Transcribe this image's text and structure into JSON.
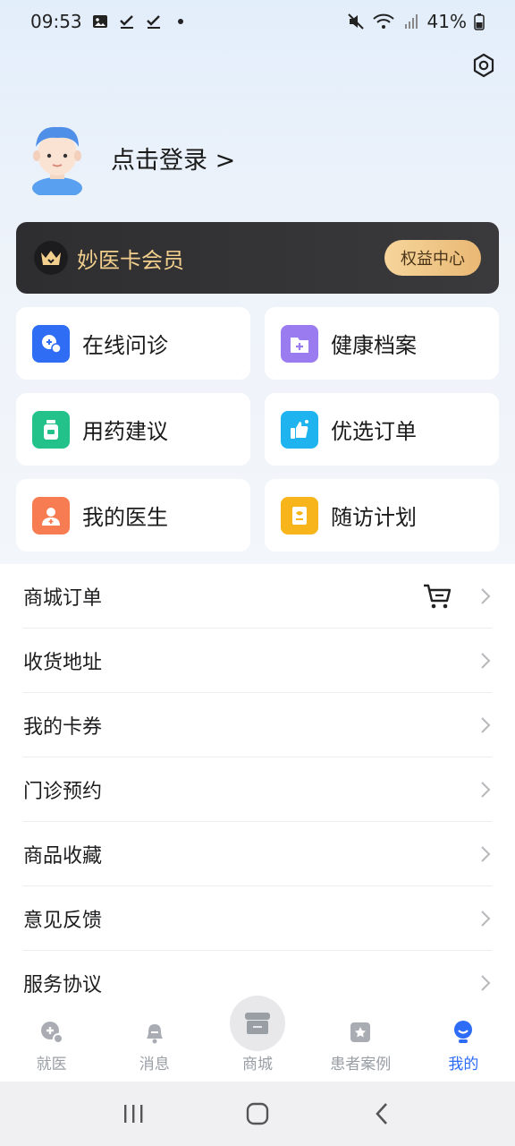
{
  "status": {
    "time": "09:53",
    "battery": "41%"
  },
  "profile": {
    "login_text": "点击登录 >"
  },
  "member": {
    "title": "妙医卡会员",
    "button": "权益中心"
  },
  "grid": [
    {
      "label": "在线问诊",
      "icon": "online-consult-icon",
      "color": "#2f6df5"
    },
    {
      "label": "健康档案",
      "icon": "health-record-icon",
      "color": "#9b7cf0"
    },
    {
      "label": "用药建议",
      "icon": "medicine-icon",
      "color": "#22c28a"
    },
    {
      "label": "优选订单",
      "icon": "thumbs-up-icon",
      "color": "#1fb4f0"
    },
    {
      "label": "我的医生",
      "icon": "doctor-icon",
      "color": "#f77c52"
    },
    {
      "label": "随访计划",
      "icon": "follow-up-icon",
      "color": "#f8b51b"
    }
  ],
  "menu": [
    {
      "label": "商城订单"
    },
    {
      "label": "收货地址"
    },
    {
      "label": "我的卡券"
    },
    {
      "label": "门诊预约"
    },
    {
      "label": "商品收藏"
    },
    {
      "label": "意见反馈"
    },
    {
      "label": "服务协议"
    }
  ],
  "tabs": [
    {
      "label": "就医"
    },
    {
      "label": "消息"
    },
    {
      "label": "商城"
    },
    {
      "label": "患者案例"
    },
    {
      "label": "我的"
    }
  ],
  "colors": {
    "accent": "#2c6cf6",
    "gold": "#f2cf8d"
  }
}
